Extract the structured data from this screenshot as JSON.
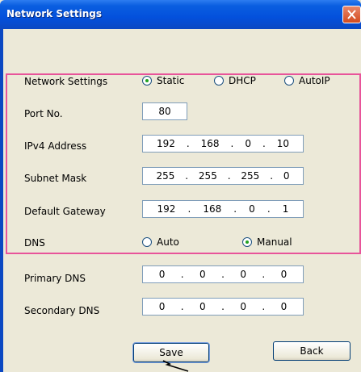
{
  "window": {
    "title": "Network Settings",
    "close_label": "X"
  },
  "network_settings": {
    "label": "Network Settings",
    "options": [
      "Static",
      "DHCP",
      "AutoIP"
    ],
    "selected": "Static"
  },
  "port": {
    "label": "Port No.",
    "value": "80"
  },
  "ipv4": {
    "label": "IPv4 Address",
    "octets": [
      "192",
      "168",
      "0",
      "10"
    ]
  },
  "subnet": {
    "label": "Subnet Mask",
    "octets": [
      "255",
      "255",
      "255",
      "0"
    ]
  },
  "gateway": {
    "label": "Default Gateway",
    "octets": [
      "192",
      "168",
      "0",
      "1"
    ]
  },
  "dns": {
    "label": "DNS",
    "options": [
      "Auto",
      "Manual"
    ],
    "selected": "Manual"
  },
  "primary_dns": {
    "label": "Primary DNS",
    "octets": [
      "0",
      "0",
      "0",
      "0"
    ]
  },
  "secondary_dns": {
    "label": "Secondary DNS",
    "octets": [
      "0",
      "0",
      "0",
      "0"
    ]
  },
  "buttons": {
    "save": "Save",
    "back": "Back"
  },
  "colors": {
    "highlight_border": "#e8549a",
    "title_bar": "#0350dc",
    "radio_dot": "#21a121"
  }
}
